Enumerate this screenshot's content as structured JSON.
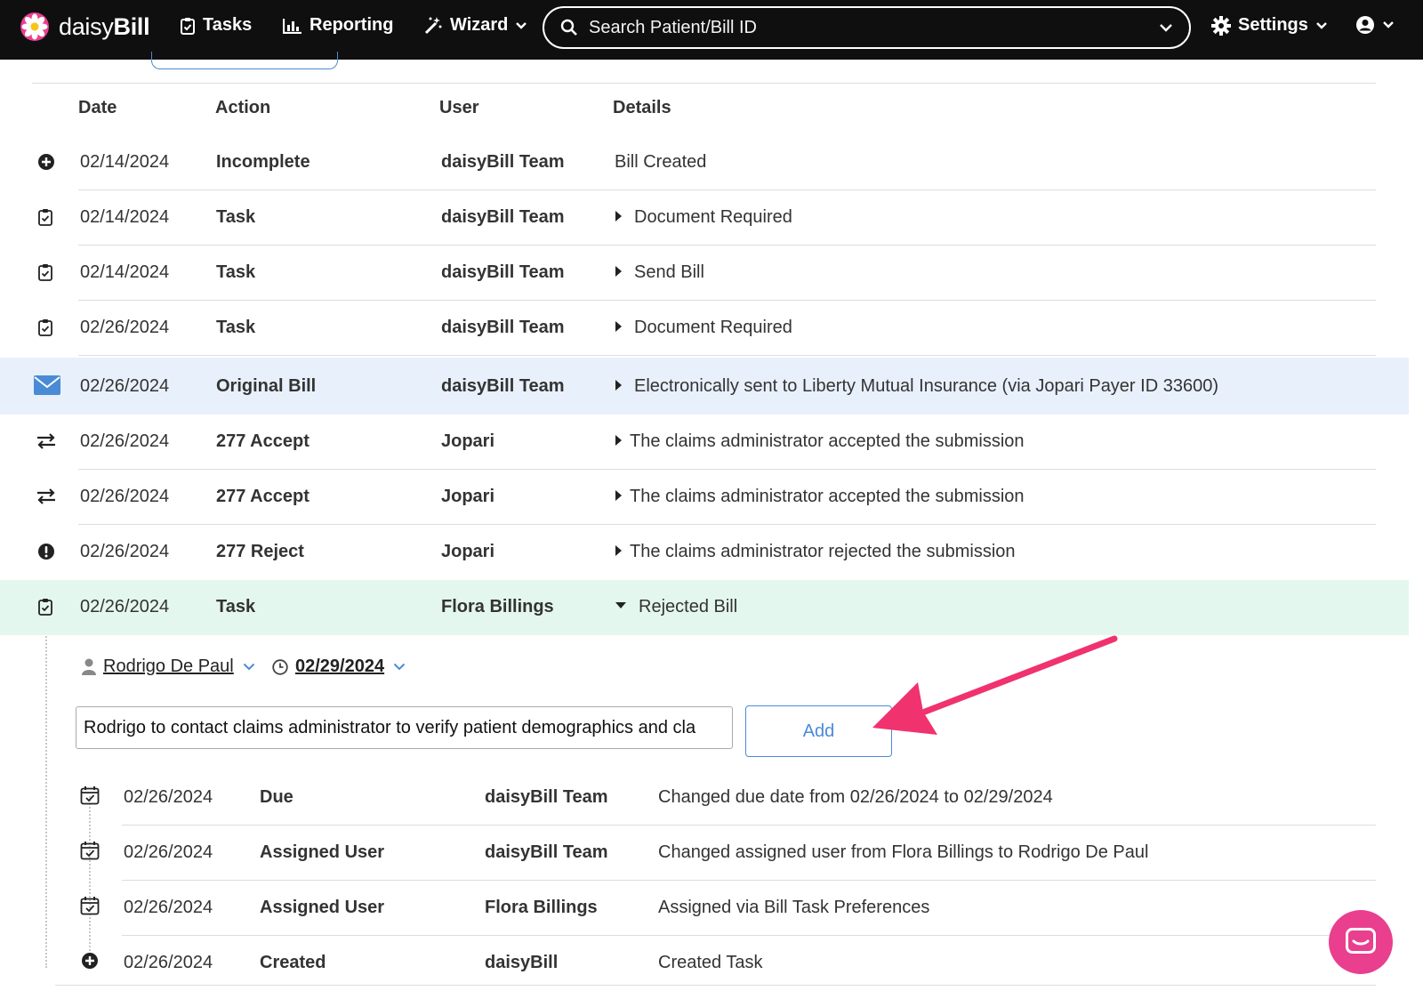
{
  "nav": {
    "brand_light": "daisy",
    "brand_bold": "Bill",
    "tasks": "Tasks",
    "reporting": "Reporting",
    "wizard": "Wizard",
    "search_placeholder": "Search Patient/Bill ID",
    "settings": "Settings"
  },
  "table": {
    "headers": {
      "date": "Date",
      "action": "Action",
      "user": "User",
      "details": "Details"
    },
    "rows": [
      {
        "icon": "plus-circle-icon",
        "date": "02/14/2024",
        "action": "Incomplete",
        "user": "daisyBill Team",
        "details": "Bill Created",
        "expander": "none"
      },
      {
        "icon": "clipboard-check-icon",
        "date": "02/14/2024",
        "action": "Task",
        "user": "daisyBill Team",
        "details": "Document Required",
        "expander": "right"
      },
      {
        "icon": "clipboard-check-icon",
        "date": "02/14/2024",
        "action": "Task",
        "user": "daisyBill Team",
        "details": "Send Bill",
        "expander": "right"
      },
      {
        "icon": "clipboard-check-icon",
        "date": "02/26/2024",
        "action": "Task",
        "user": "daisyBill Team",
        "details": "Document Required",
        "expander": "right"
      },
      {
        "icon": "envelope-icon",
        "date": "02/26/2024",
        "action": "Original Bill",
        "user": "daisyBill Team",
        "details": "Electronically sent to Liberty Mutual Insurance (via Jopari Payer ID 33600)",
        "expander": "right"
      },
      {
        "icon": "exchange-icon",
        "date": "02/26/2024",
        "action": "277 Accept",
        "user": "Jopari",
        "details": "The claims administrator accepted the submission",
        "expander": "right"
      },
      {
        "icon": "exchange-icon",
        "date": "02/26/2024",
        "action": "277 Accept",
        "user": "Jopari",
        "details": "The claims administrator accepted the submission",
        "expander": "right"
      },
      {
        "icon": "exclamation-circle-icon",
        "date": "02/26/2024",
        "action": "277 Reject",
        "user": "Jopari",
        "details": "The claims administrator rejected the submission",
        "expander": "right"
      },
      {
        "icon": "clipboard-check-icon",
        "date": "02/26/2024",
        "action": "Task",
        "user": "Flora Billings",
        "details": "Rejected Bill",
        "expander": "down"
      }
    ]
  },
  "task": {
    "assignee": "Rodrigo De Paul",
    "due_date": "02/29/2024",
    "note_value": "Rodrigo to contact claims administrator to verify patient demographics and cla",
    "add_label": "Add",
    "history": [
      {
        "icon": "calendar-check-icon",
        "date": "02/26/2024",
        "action": "Due",
        "user": "daisyBill Team",
        "details": "Changed due date from 02/26/2024 to 02/29/2024"
      },
      {
        "icon": "calendar-check-icon",
        "date": "02/26/2024",
        "action": "Assigned User",
        "user": "daisyBill Team",
        "details": "Changed assigned user from Flora Billings to Rodrigo De Paul"
      },
      {
        "icon": "calendar-check-icon",
        "date": "02/26/2024",
        "action": "Assigned User",
        "user": "Flora Billings",
        "details": "Assigned via Bill Task Preferences"
      },
      {
        "icon": "plus-circle-icon",
        "date": "02/26/2024",
        "action": "Created",
        "user": "daisyBill",
        "details": "Created Task"
      }
    ]
  },
  "colors": {
    "accent_blue": "#4a8bd6",
    "arrow_pink": "#f0326e",
    "chat_pink": "#e93f8e",
    "row_blue": "#e8f0fb",
    "row_green": "#e4f7ee"
  }
}
